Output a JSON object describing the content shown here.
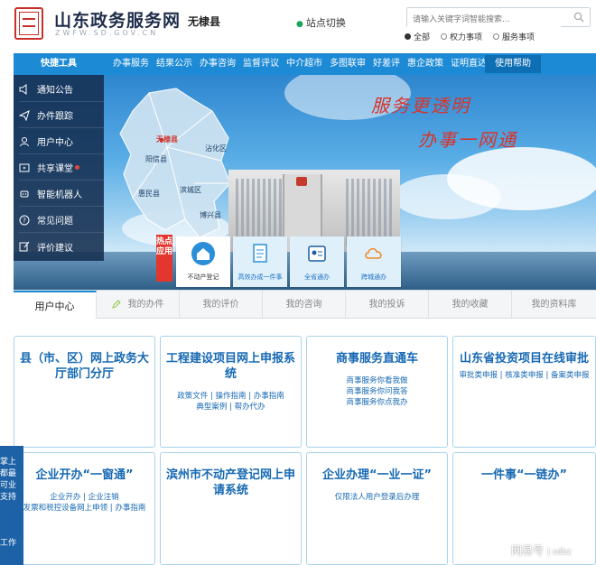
{
  "header": {
    "site_title": "山东政务服务网",
    "site_sub": "ZWFW.SD.GOV.CN",
    "county": "无棣县",
    "switch_site": "站点切换",
    "search_placeholder": "请输入关键字词智能搜索...",
    "search_scope": [
      {
        "label": "全部",
        "selected": true
      },
      {
        "label": "权力事项",
        "selected": false
      },
      {
        "label": "服务事项",
        "selected": false
      }
    ]
  },
  "nav": {
    "quick": "快捷工具",
    "items": [
      "办事服务",
      "结果公示",
      "办事咨询",
      "监督评议",
      "中介超市",
      "多图联审",
      "好差评",
      "惠企政策",
      "证明直达"
    ],
    "help": "使用帮助"
  },
  "sidebar": {
    "items": [
      {
        "label": "通知公告",
        "icon": "speaker-icon"
      },
      {
        "label": "办件跟踪",
        "icon": "send-icon"
      },
      {
        "label": "用户中心",
        "icon": "user-icon"
      },
      {
        "label": "共享课堂",
        "icon": "tv-icon"
      },
      {
        "label": "智能机器人",
        "icon": "robot-icon"
      },
      {
        "label": "常见问题",
        "icon": "question-icon"
      },
      {
        "label": "评价建议",
        "icon": "edit-icon"
      }
    ]
  },
  "banner": {
    "slogan1": "服务更透明",
    "slogan2": "办事一网通",
    "cities": [
      "无棣县",
      "沾化区",
      "阳信县",
      "滨城区",
      "惠民县",
      "博兴县"
    ]
  },
  "hot": {
    "tag": "热点应用",
    "apps": [
      {
        "label": "不动产登记",
        "icon": "house-icon"
      },
      {
        "label": "高效办成一件事",
        "icon": "document-icon"
      },
      {
        "label": "全省通办",
        "icon": "id-card-icon"
      },
      {
        "label": "跨城通办",
        "icon": "cloud-sync-icon"
      }
    ]
  },
  "tabs": [
    "用户中心",
    "我的办件",
    "我的评价",
    "我的咨询",
    "我的投诉",
    "我的收藏",
    "我的资料库"
  ],
  "cards": [
    {
      "title": "县（市、区）网上政务大厅部门分厅",
      "links": []
    },
    {
      "title": "工程建设项目网上申报系统",
      "links": [
        "政策文件 | 操作指南 | 办事指南",
        "典型案例 | 帮办代办"
      ]
    },
    {
      "title": "商事服务直通车",
      "links": [
        "商事服务你看我做",
        "商事服务你问我答",
        "商事服务你点我办"
      ]
    },
    {
      "title": "山东省投资项目在线审批",
      "links": [
        "审批类申报 | 核准类申报 | 备案类申报"
      ]
    },
    {
      "title": "企业开办“一窗通”",
      "links": [
        "企业开办 | 企业注销",
        "发票和税控设备网上申领 | 办事指南"
      ]
    },
    {
      "title": "滨州市不动产登记网上申请系统",
      "links": []
    },
    {
      "title": "企业办理“一业一证”",
      "links": [
        "仅限法人用户登录后办理"
      ]
    },
    {
      "title": "一件事“一链办”",
      "links": []
    }
  ],
  "float_left": {
    "text1": "掌上都最可业支持",
    "text2": "工作"
  },
  "watermark": {
    "brand": "网易号",
    "sub": "| sdbz"
  },
  "colors": {
    "primary": "#1d8ad6",
    "card_title": "#1769b3",
    "hot_red": "#e2362e",
    "slogan_red": "#d8342c"
  }
}
